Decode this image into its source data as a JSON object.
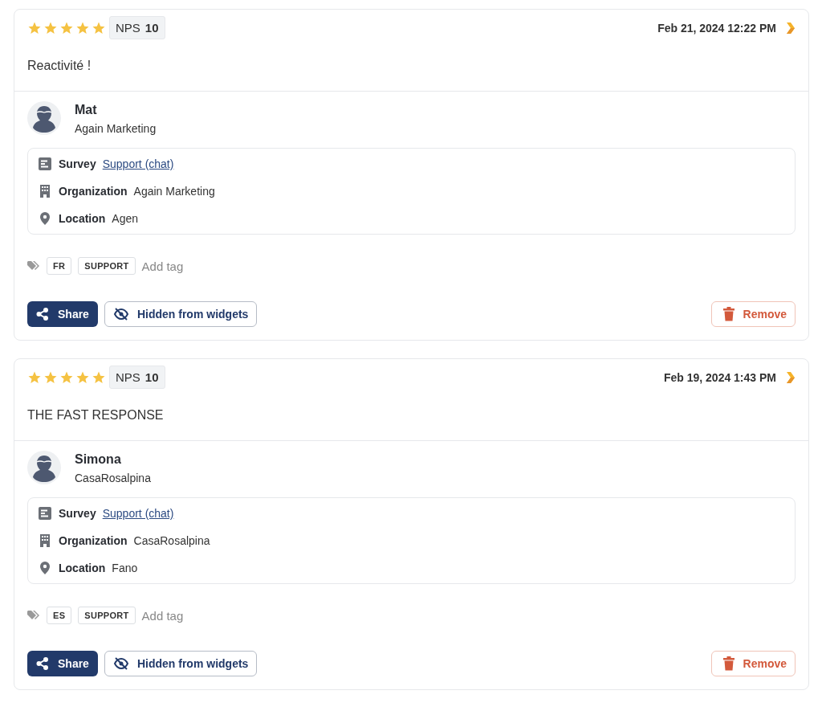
{
  "reviews": [
    {
      "stars": 5,
      "nps_label": "NPS",
      "nps": "10",
      "date": "Feb 21, 2024 12:22 PM",
      "comment": "Reactivité !",
      "author": {
        "name": "Mat",
        "company": "Again Marketing"
      },
      "details": [
        {
          "kind": "survey",
          "label": "Survey",
          "value": "Support (chat)"
        },
        {
          "kind": "organization",
          "label": "Organization",
          "value": "Again Marketing"
        },
        {
          "kind": "location",
          "label": "Location",
          "value": "Agen"
        }
      ],
      "tags": [
        "FR",
        "SUPPORT"
      ],
      "add_tag": "Add tag",
      "share": "Share",
      "hidden": "Hidden from widgets",
      "remove": "Remove"
    },
    {
      "stars": 5,
      "nps_label": "NPS",
      "nps": "10",
      "date": "Feb 19, 2024 1:43 PM",
      "comment": "THE FAST RESPONSE",
      "author": {
        "name": "Simona",
        "company": "CasaRosalpina"
      },
      "details": [
        {
          "kind": "survey",
          "label": "Survey",
          "value": "Support (chat)"
        },
        {
          "kind": "organization",
          "label": "Organization",
          "value": "CasaRosalpina"
        },
        {
          "kind": "location",
          "label": "Location",
          "value": "Fano"
        }
      ],
      "tags": [
        "ES",
        "SUPPORT"
      ],
      "add_tag": "Add tag",
      "share": "Share",
      "hidden": "Hidden from widgets",
      "remove": "Remove"
    }
  ]
}
